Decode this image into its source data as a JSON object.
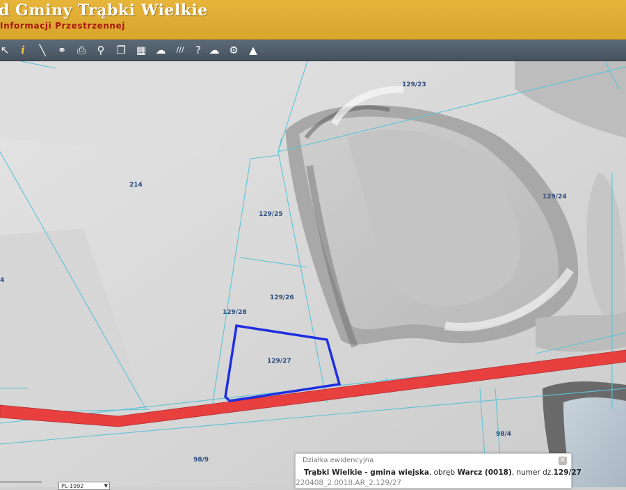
{
  "header": {
    "title": "d Gminy Trąbki Wielkie",
    "subtitle": "Informacji Przestrzennej"
  },
  "toolbar": {
    "tools": [
      {
        "icon": "pointer-arrow-icon",
        "glyph": "↖"
      },
      {
        "icon": "info-icon",
        "glyph": "i"
      },
      {
        "icon": "measure-line-icon",
        "glyph": "╲"
      },
      {
        "icon": "link-icon",
        "glyph": "⚭"
      },
      {
        "icon": "print-icon",
        "glyph": "⎙"
      },
      {
        "icon": "location-pin-icon",
        "glyph": "⚲"
      },
      {
        "icon": "copy-icon",
        "glyph": "❐"
      },
      {
        "icon": "layout-icon",
        "glyph": "▦"
      },
      {
        "icon": "speech-bubble-icon",
        "glyph": "☁"
      },
      {
        "icon": "hatch-icon",
        "glyph": "///"
      },
      {
        "icon": "help-icon",
        "glyph": "?"
      },
      {
        "icon": "cloud-download-icon",
        "glyph": "☁"
      },
      {
        "icon": "settings-gears-icon",
        "glyph": "⚙"
      },
      {
        "icon": "triangle-warning-icon",
        "glyph": "▲"
      }
    ]
  },
  "map": {
    "parcel_labels": [
      {
        "id": "129/23"
      },
      {
        "id": "214"
      },
      {
        "id": "129/24"
      },
      {
        "id": "129/25"
      },
      {
        "id": "129/26"
      },
      {
        "id": "129/28"
      },
      {
        "id": "129/27"
      },
      {
        "id": "98/4"
      },
      {
        "id": "98/9"
      },
      {
        "id": "4"
      }
    ],
    "road_color": "#e8403f",
    "selected_parcel_color": "#1f2ee0",
    "parcel_line_color": "#5bc3d6"
  },
  "popup": {
    "header": "Działka ewidencyjna",
    "municipality": "Trąbki Wielkie - gmina wiejska",
    "obreb_label": ", obręb ",
    "obreb_value": "Warcz (0018)",
    "numer_label": ", numer dz.",
    "numer_value": "129/27",
    "code": "220408_2.0018.AR_2.129/27",
    "close": "✕"
  },
  "crs": {
    "value": "PL-1992"
  }
}
